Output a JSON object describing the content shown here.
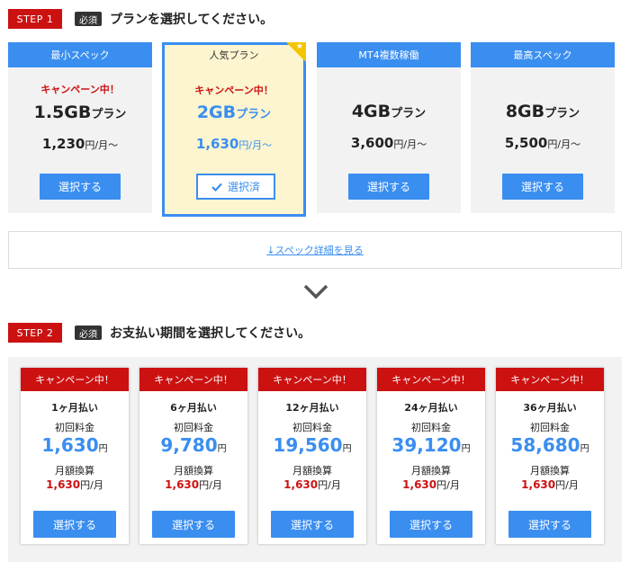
{
  "step1": {
    "badge": "STEP 1",
    "required": "必須",
    "title": "プランを選択してください。"
  },
  "plans": [
    {
      "name": "最小スペック",
      "campaign": "キャンペーン中！",
      "gb": "1.5GB",
      "gb_unit": "プラン",
      "price": "1,230",
      "price_unit": "円/月〜",
      "button": "選択する"
    },
    {
      "name": "人気プラン",
      "campaign": "キャンペーン中！",
      "gb": "2GB",
      "gb_unit": "プラン",
      "price": "1,630",
      "price_unit": "円/月〜",
      "button": "選択済"
    },
    {
      "name": "MT4複数稼働",
      "campaign": "",
      "gb": "4GB",
      "gb_unit": "プラン",
      "price": "3,600",
      "price_unit": "円/月〜",
      "button": "選択する"
    },
    {
      "name": "最高スペック",
      "campaign": "",
      "gb": "8GB",
      "gb_unit": "プラン",
      "price": "5,500",
      "price_unit": "円/月〜",
      "button": "選択する"
    }
  ],
  "detail_link": "↓スペック詳細を見る",
  "step2": {
    "badge": "STEP 2",
    "required": "必須",
    "title": "お支払い期間を選択してください。"
  },
  "periods": [
    {
      "campaign": "キャンペーン中！",
      "name": "1ヶ月払い",
      "initial_label": "初回料金",
      "initial": "1,630",
      "initial_unit": "円",
      "monthly_label": "月額換算",
      "monthly": "1,630",
      "monthly_unit": "円/月",
      "button": "選択する"
    },
    {
      "campaign": "キャンペーン中！",
      "name": "6ヶ月払い",
      "initial_label": "初回料金",
      "initial": "9,780",
      "initial_unit": "円",
      "monthly_label": "月額換算",
      "monthly": "1,630",
      "monthly_unit": "円/月",
      "button": "選択する"
    },
    {
      "campaign": "キャンペーン中！",
      "name": "12ヶ月払い",
      "initial_label": "初回料金",
      "initial": "19,560",
      "initial_unit": "円",
      "monthly_label": "月額換算",
      "monthly": "1,630",
      "monthly_unit": "円/月",
      "button": "選択する"
    },
    {
      "campaign": "キャンペーン中！",
      "name": "24ヶ月払い",
      "initial_label": "初回料金",
      "initial": "39,120",
      "initial_unit": "円",
      "monthly_label": "月額換算",
      "monthly": "1,630",
      "monthly_unit": "円/月",
      "button": "選択する"
    },
    {
      "campaign": "キャンペーン中！",
      "name": "36ヶ月払い",
      "initial_label": "初回料金",
      "initial": "58,680",
      "initial_unit": "円",
      "monthly_label": "月額換算",
      "monthly": "1,630",
      "monthly_unit": "円/月",
      "button": "選択する"
    }
  ],
  "colors": {
    "accent": "#3a8ef0",
    "campaign_red": "#cc1111",
    "selected_bg": "#fdf5cf",
    "star": "#f4c400"
  },
  "icons": {
    "selected_check": "check-icon",
    "popular": "star-icon",
    "next_step": "chevron-down-icon"
  }
}
